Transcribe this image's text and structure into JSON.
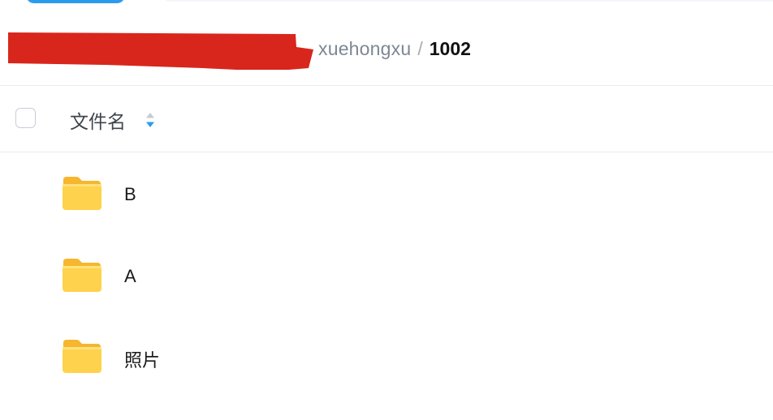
{
  "breadcrumb": {
    "parent": "xuehongxu",
    "separator": "/",
    "current": "1002"
  },
  "table": {
    "column_name": "文件名",
    "sort_icon": "sort-ascending-descending-icon"
  },
  "files": [
    {
      "name": "B",
      "icon": "folder-icon"
    },
    {
      "name": "A",
      "icon": "folder-icon"
    },
    {
      "name": "照片",
      "icon": "folder-icon"
    }
  ],
  "colors": {
    "accent": "#2b9bf0",
    "folder": "#ffcc47",
    "redaction": "#d9261c"
  }
}
